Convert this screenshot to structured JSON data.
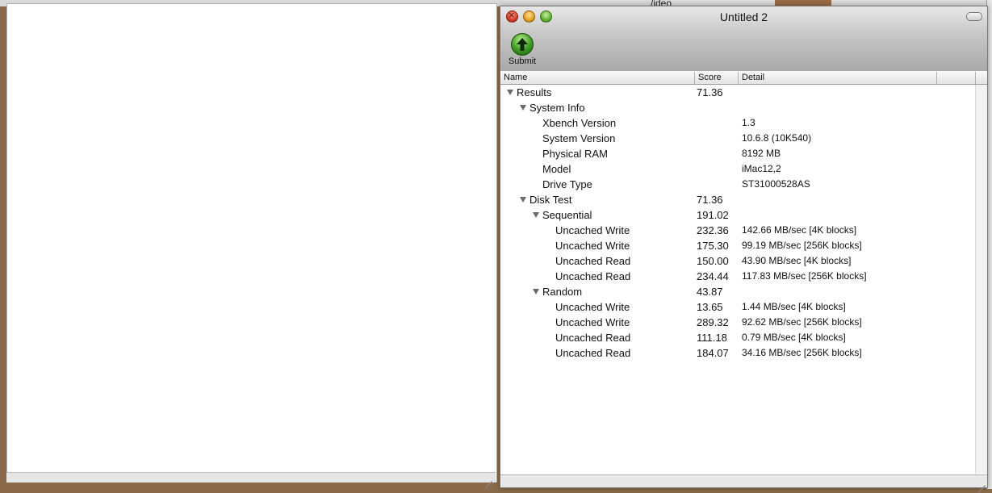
{
  "background": {
    "partial_label": "/ideo"
  },
  "window": {
    "title": "Untitled 2"
  },
  "toolbar": {
    "submit_label": "Submit"
  },
  "columns": {
    "name": "Name",
    "score": "Score",
    "detail": "Detail"
  },
  "rows": [
    {
      "name": "Results",
      "score": "71.36",
      "detail": "",
      "level": 0,
      "expanded": true
    },
    {
      "name": "System Info",
      "score": "",
      "detail": "",
      "level": 1,
      "expanded": true
    },
    {
      "name": "Xbench Version",
      "score": "",
      "detail": "1.3",
      "level": 2
    },
    {
      "name": "System Version",
      "score": "",
      "detail": "10.6.8 (10K540)",
      "level": 2
    },
    {
      "name": "Physical RAM",
      "score": "",
      "detail": "8192 MB",
      "level": 2
    },
    {
      "name": "Model",
      "score": "",
      "detail": "iMac12,2",
      "level": 2
    },
    {
      "name": "Drive Type",
      "score": "",
      "detail": "ST31000528AS",
      "level": 2
    },
    {
      "name": "Disk Test",
      "score": "71.36",
      "detail": "",
      "level": 1,
      "expanded": true
    },
    {
      "name": "Sequential",
      "score": "191.02",
      "detail": "",
      "level": 2,
      "expanded": true
    },
    {
      "name": "Uncached Write",
      "score": "232.36",
      "detail": "142.66 MB/sec [4K blocks]",
      "level": 3
    },
    {
      "name": "Uncached Write",
      "score": "175.30",
      "detail": "99.19 MB/sec [256K blocks]",
      "level": 3
    },
    {
      "name": "Uncached Read",
      "score": "150.00",
      "detail": "43.90 MB/sec [4K blocks]",
      "level": 3
    },
    {
      "name": "Uncached Read",
      "score": "234.44",
      "detail": "117.83 MB/sec [256K blocks]",
      "level": 3
    },
    {
      "name": "Random",
      "score": "43.87",
      "detail": "",
      "level": 2,
      "expanded": true
    },
    {
      "name": "Uncached Write",
      "score": "13.65",
      "detail": "1.44 MB/sec [4K blocks]",
      "level": 3
    },
    {
      "name": "Uncached Write",
      "score": "289.32",
      "detail": "92.62 MB/sec [256K blocks]",
      "level": 3
    },
    {
      "name": "Uncached Read",
      "score": "111.18",
      "detail": "0.79 MB/sec [4K blocks]",
      "level": 3
    },
    {
      "name": "Uncached Read",
      "score": "184.07",
      "detail": "34.16 MB/sec [256K blocks]",
      "level": 3
    }
  ],
  "icons": {
    "close": "close-icon",
    "minimize": "minimize-icon",
    "zoom": "zoom-icon",
    "submit": "upload-arrow-icon",
    "disclosure": "disclosure-triangle-icon"
  },
  "colors": {
    "close": "#d23a2a",
    "minimize": "#e0a020",
    "zoom": "#5fb030",
    "submit": "#3a9a20"
  }
}
